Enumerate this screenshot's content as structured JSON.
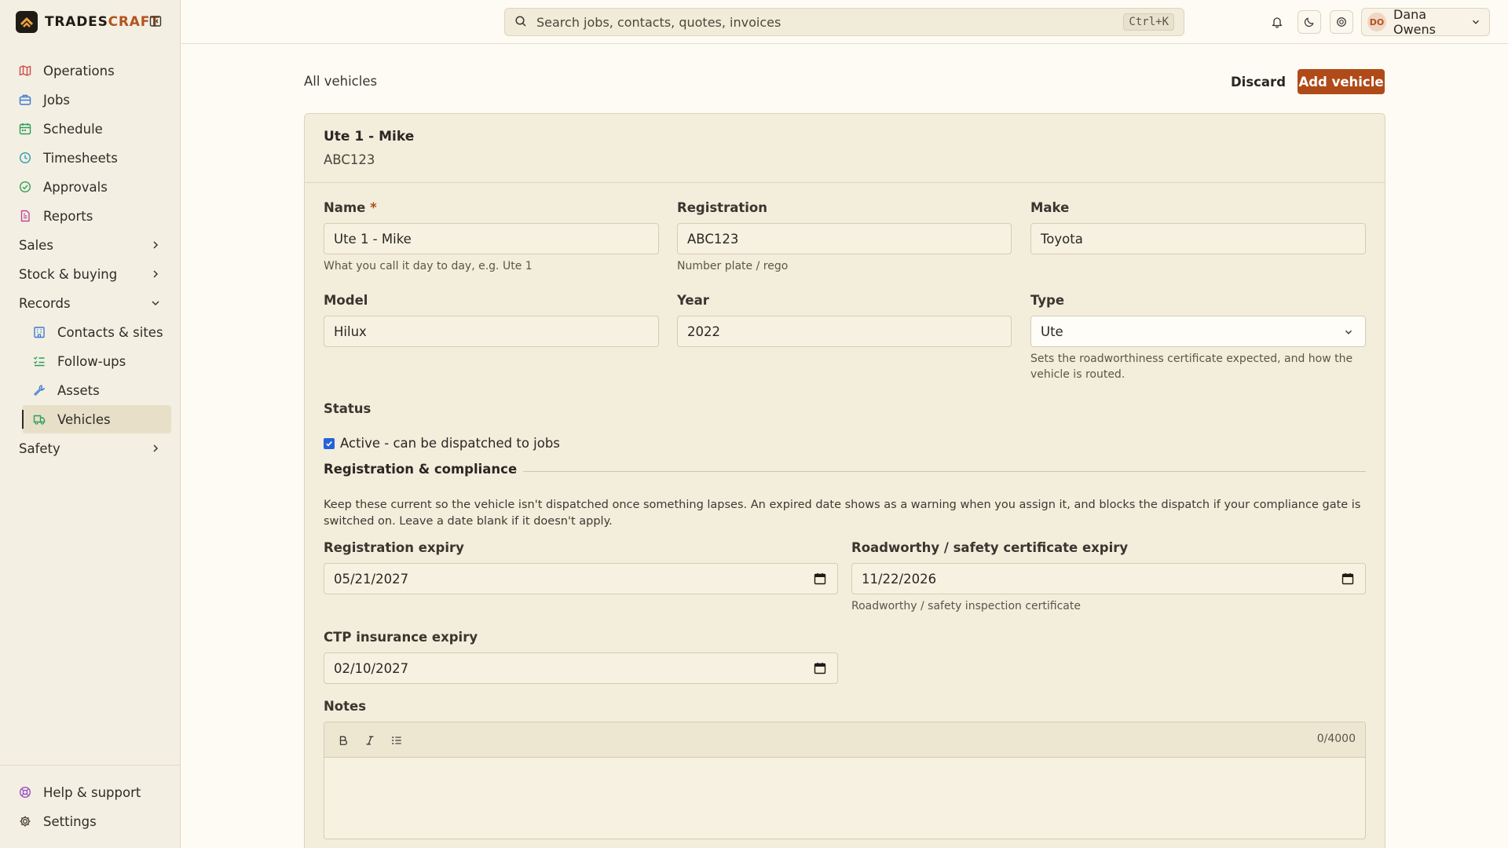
{
  "brand": {
    "name_part1": "TRADES",
    "name_part2": "CRAFT"
  },
  "sidebar": {
    "items": [
      {
        "label": "Operations",
        "icon": "map-icon",
        "color": "#d04a4a"
      },
      {
        "label": "Jobs",
        "icon": "briefcase-icon",
        "color": "#3b7bd4"
      },
      {
        "label": "Schedule",
        "icon": "calendar-icon",
        "color": "#2e9e58"
      },
      {
        "label": "Timesheets",
        "icon": "clock-icon",
        "color": "#2a9bb0"
      },
      {
        "label": "Approvals",
        "icon": "check-circle-icon",
        "color": "#2e9e58"
      },
      {
        "label": "Reports",
        "icon": "file-icon",
        "color": "#c0459a"
      }
    ],
    "groups": {
      "sales": "Sales",
      "stock": "Stock & buying",
      "records": "Records",
      "safety": "Safety"
    },
    "records_items": [
      {
        "label": "Contacts & sites",
        "icon": "building-icon"
      },
      {
        "label": "Follow-ups",
        "icon": "list-checks-icon"
      },
      {
        "label": "Assets",
        "icon": "wrench-icon"
      },
      {
        "label": "Vehicles",
        "icon": "truck-icon"
      }
    ],
    "bottom": {
      "help": "Help & support",
      "settings": "Settings"
    }
  },
  "topbar": {
    "search_placeholder": "Search jobs, contacts, quotes, invoices",
    "shortcut": "Ctrl+K",
    "user": {
      "initials": "DO",
      "name": "Dana Owens"
    }
  },
  "page": {
    "breadcrumb": "All vehicles",
    "discard_label": "Discard",
    "add_label": "Add vehicle"
  },
  "vehicle": {
    "title": "Ute 1 - Mike",
    "subtitle": "ABC123"
  },
  "form": {
    "name": {
      "label": "Name",
      "required_mark": "*",
      "value": "Ute 1 - Mike",
      "hint": "What you call it day to day, e.g. Ute 1"
    },
    "registration": {
      "label": "Registration",
      "value": "ABC123",
      "hint": "Number plate / rego"
    },
    "make": {
      "label": "Make",
      "value": "Toyota"
    },
    "model": {
      "label": "Model",
      "value": "Hilux"
    },
    "year": {
      "label": "Year",
      "value": "2022"
    },
    "type": {
      "label": "Type",
      "value": "Ute",
      "hint": "Sets the roadworthiness certificate expected, and how the vehicle is routed."
    },
    "status": {
      "label": "Status",
      "checkbox_label": "Active - can be dispatched to jobs",
      "checked": true
    },
    "compliance": {
      "title": "Registration & compliance",
      "description": "Keep these current so the vehicle isn't dispatched once something lapses. An expired date shows as a warning when you assign it, and blocks the dispatch if your compliance gate is switched on. Leave a date blank if it doesn't apply.",
      "rego_expiry": {
        "label": "Registration expiry",
        "value": "05/21/2027"
      },
      "roadworthy_expiry": {
        "label": "Roadworthy / safety certificate expiry",
        "value": "11/22/2026",
        "hint": "Roadworthy / safety inspection certificate"
      },
      "ctp_expiry": {
        "label": "CTP insurance expiry",
        "value": "02/10/2027"
      }
    },
    "notes": {
      "label": "Notes",
      "counter": "0/4000"
    }
  },
  "colors": {
    "accent": "#b04a18",
    "checkbox": "#2563d8",
    "sidebar_bg": "#f3efe2"
  }
}
